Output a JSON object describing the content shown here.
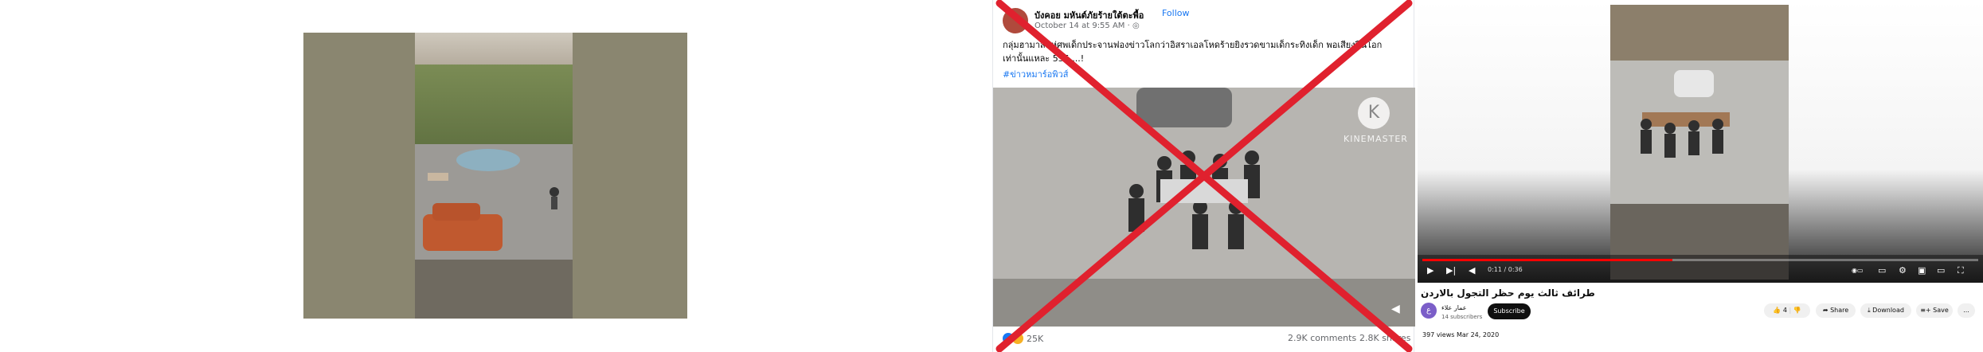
{
  "facebook_post": {
    "author": "บังคอย มหันต์ภัยร้ายใต้ตะพื้อ",
    "follow_label": "Follow",
    "date": "October 14 at 9:55 AM · ",
    "text": "กลุ่มฮามาสแห่ศพเด็กประจานฟองข่าวโลกว่าอิสราเอลโหดร้ายยิงรวดขามเด็กระทิงเด็ก พอเสียงปืนโอกเท่านั้นแหละ 555 ...!",
    "hashtag": "#ข่าวหมาร์อพิวส์",
    "watermark": "KINEMASTER",
    "reactions_count": "25K",
    "comments": "2.9K comments",
    "shares": "2.8K shares",
    "overlay_color": "#e0212e"
  },
  "youtube": {
    "time": "0:11 / 0:36",
    "progress": 0.45,
    "title": "طرائف ثالث يوم حظر التجول بالاردن",
    "channel_initial": "ع",
    "channel_name": "عمار علاء",
    "subscribers": "14 subscribers",
    "subscribe_label": "Subscribe",
    "likes": "4",
    "share_label": "Share",
    "download_label": "Download",
    "save_label": "Save",
    "more_label": "...",
    "meta": "397 views  Mar 24, 2020",
    "accent": "#ff0000"
  }
}
